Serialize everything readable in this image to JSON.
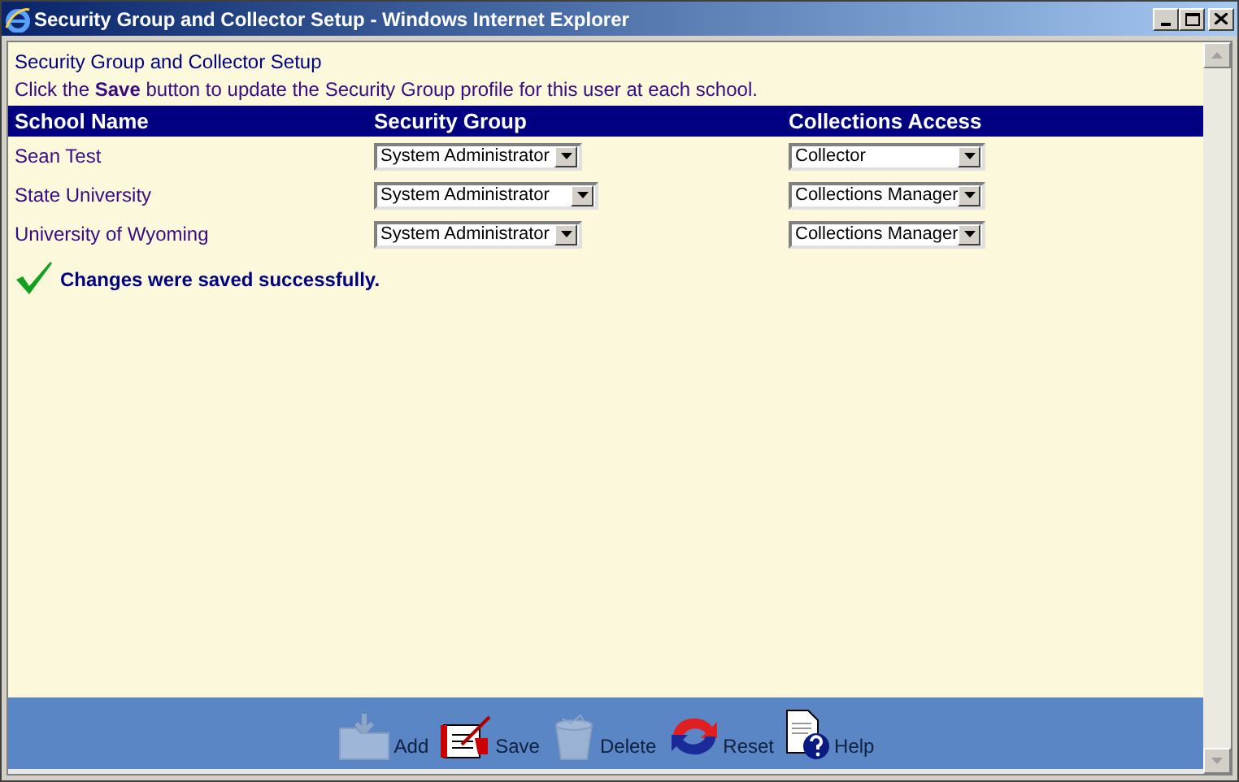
{
  "window": {
    "title": "Security Group and Collector Setup - Windows Internet Explorer"
  },
  "page": {
    "heading": "Security Group and Collector Setup",
    "instructions": "Click the **Save** button to update the Security Group profile for this user at each school."
  },
  "table": {
    "columns": [
      "School Name",
      "Security Group",
      "Collections Access"
    ],
    "rows": [
      {
        "school": "Sean Test",
        "security_group": "System Administrator",
        "collections_access": "Collector"
      },
      {
        "school": "State University",
        "security_group": "System Administrator",
        "collections_access": "Collections Manager"
      },
      {
        "school": "University of Wyoming",
        "security_group": "System Administrator",
        "collections_access": "Collections Manager"
      }
    ]
  },
  "status_message": "Changes were saved successfully.",
  "toolbar": [
    {
      "kind": "add",
      "label": "Add",
      "disabled": true
    },
    {
      "kind": "save",
      "label": "Save",
      "disabled": false
    },
    {
      "kind": "delete",
      "label": "Delete",
      "disabled": true
    },
    {
      "kind": "reset",
      "label": "Reset",
      "disabled": false
    },
    {
      "kind": "help",
      "label": "Help",
      "disabled": false
    }
  ]
}
